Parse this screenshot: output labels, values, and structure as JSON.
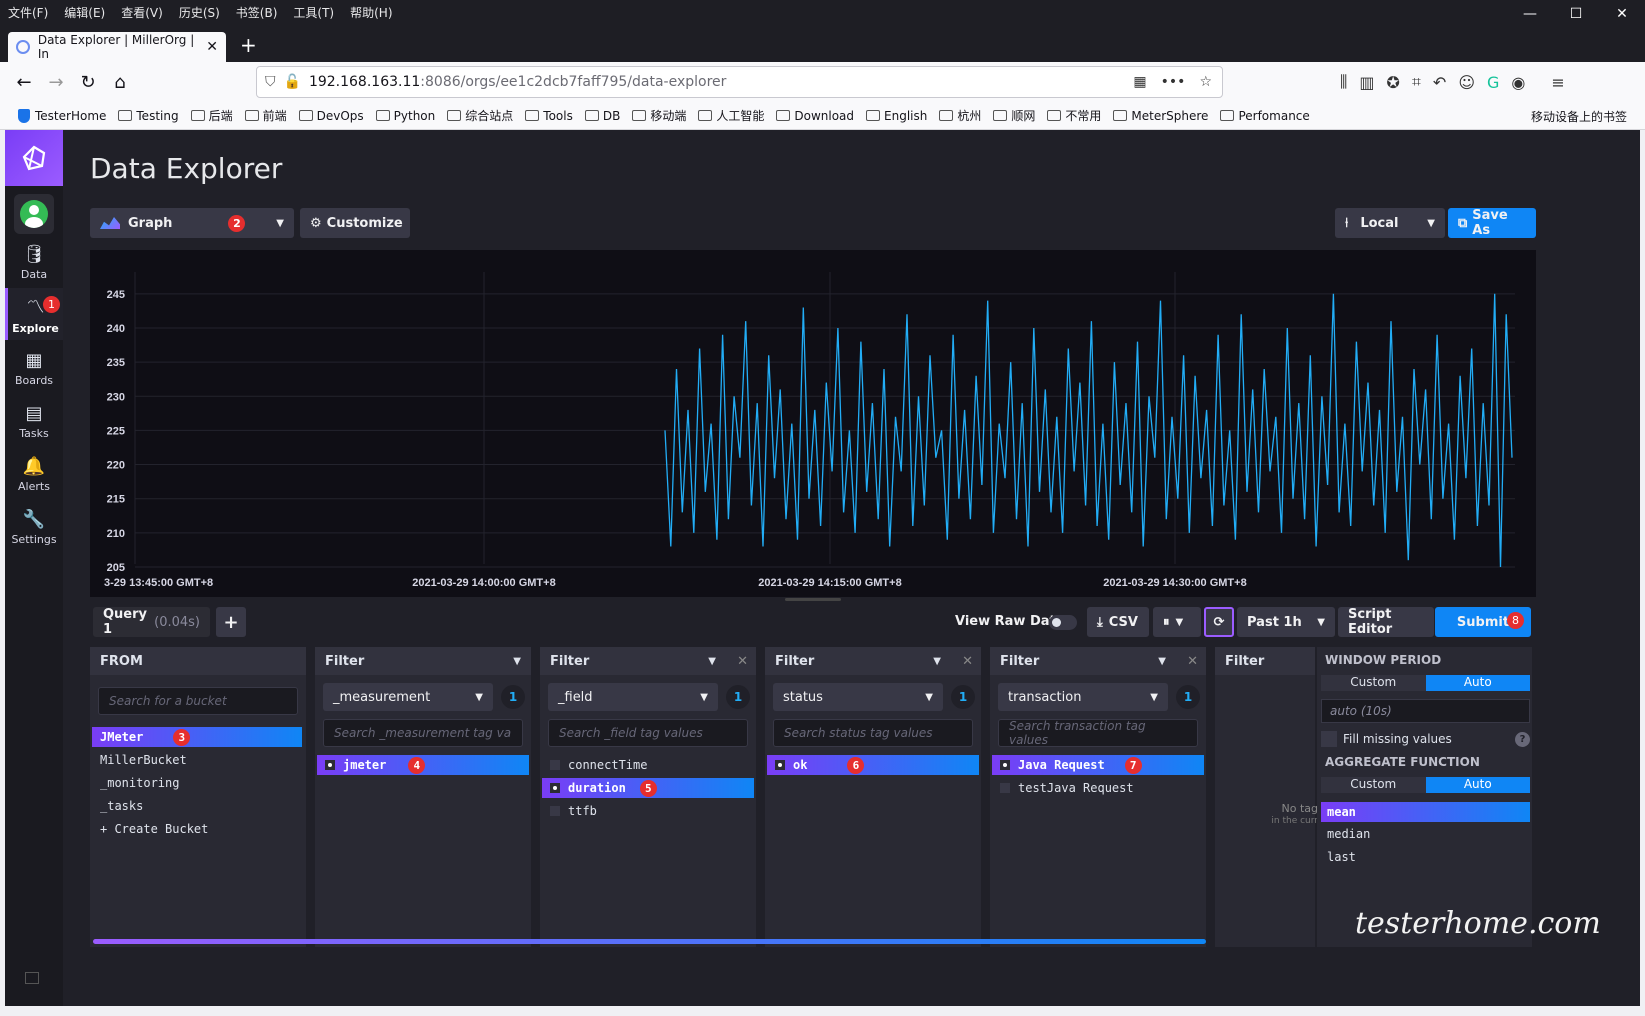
{
  "menubar": {
    "items": [
      "文件(F)",
      "编辑(E)",
      "查看(V)",
      "历史(S)",
      "书签(B)",
      "工具(T)",
      "帮助(H)"
    ],
    "window_controls": [
      "—",
      "☐",
      "✕"
    ]
  },
  "tab": {
    "title": "Data Explorer | MillerOrg | In",
    "close": "✕",
    "new": "+"
  },
  "urlbar": {
    "host": "192.168.163.11",
    "path": ":8086/orgs/ee1c2dcb7faff795/data-explorer"
  },
  "bookmarks": {
    "items": [
      "TesterHome",
      "Testing",
      "后端",
      "前端",
      "DevOps",
      "Python",
      "综合站点",
      "Tools",
      "DB",
      "移动端",
      "人工智能",
      "Download",
      "English",
      "杭州",
      "顺网",
      "不常用",
      "MeterSphere",
      "Perfomance"
    ],
    "mobile": "移动设备上的书签"
  },
  "nav": {
    "items": [
      {
        "label": "Data",
        "icon": "database-icon"
      },
      {
        "label": "Explore",
        "icon": "explore-icon",
        "badge": "1"
      },
      {
        "label": "Boards",
        "icon": "dashboard-icon"
      },
      {
        "label": "Tasks",
        "icon": "calendar-icon"
      },
      {
        "label": "Alerts",
        "icon": "bell-icon"
      },
      {
        "label": "Settings",
        "icon": "wrench-icon"
      }
    ]
  },
  "page": {
    "title": "Data Explorer",
    "graph_type": "Graph",
    "graph_badge": "2",
    "customize": "Customize",
    "timezone": "Local",
    "save_as": "Save As"
  },
  "chart_data": {
    "type": "line",
    "color": "#22adf6",
    "ylim": [
      205,
      246
    ],
    "y_ticks": [
      245,
      240,
      235,
      230,
      225,
      220,
      215,
      210,
      205
    ],
    "x_tick_labels": [
      "3-29 13:45:00 GMT+8",
      "2021-03-29 14:00:00 GMT+8",
      "2021-03-29 14:15:00 GMT+8",
      "2021-03-29 14:30:00 GMT+8"
    ],
    "series": [
      {
        "values": [
          225,
          208,
          234,
          213,
          228,
          210,
          237,
          216,
          226,
          209,
          239,
          212,
          230,
          221,
          241,
          214,
          229,
          208,
          236,
          218,
          231,
          212,
          226,
          209,
          243,
          215,
          228,
          211,
          232,
          219,
          240,
          213,
          225,
          210,
          238,
          216,
          229,
          212,
          234,
          208,
          227,
          219,
          242,
          211,
          230,
          214,
          236,
          221,
          225,
          209,
          239,
          215,
          228,
          212,
          233,
          217,
          244,
          210,
          226,
          218,
          235,
          212,
          229,
          208,
          240,
          216,
          231,
          213,
          227,
          210,
          237,
          219,
          232,
          214,
          241,
          211,
          226,
          209,
          235,
          217,
          229,
          213,
          238,
          208,
          230,
          221,
          244,
          212,
          227,
          215,
          236,
          210,
          233,
          218,
          228,
          211,
          239,
          214,
          225,
          209,
          242,
          216,
          231,
          213,
          234,
          219,
          227,
          210,
          240,
          215,
          229,
          212,
          236,
          208,
          230,
          217,
          245,
          213,
          226,
          211,
          238,
          219,
          232,
          214,
          228,
          210,
          241,
          216,
          227,
          206,
          234,
          220,
          231,
          212,
          239,
          215,
          226,
          209,
          233,
          218,
          237,
          211,
          229,
          214,
          245,
          205,
          242,
          221
        ]
      }
    ]
  },
  "query": {
    "tab_label": "Query 1",
    "tab_time": "(0.04s)",
    "add": "+",
    "view_raw": "View Raw Data",
    "csv": "CSV",
    "pause": "⏸",
    "range": "Past 1h",
    "script_editor": "Script Editor",
    "submit": "Submit",
    "submit_badge": "8"
  },
  "from": {
    "title": "FROM",
    "placeholder": "Search for a bucket",
    "items": [
      "JMeter",
      "MillerBucket",
      "_monitoring",
      "_tasks",
      "+ Create Bucket"
    ],
    "selected_badge": "3"
  },
  "filters": [
    {
      "title": "Filter",
      "key": "_measurement",
      "count": "1",
      "placeholder": "Search _measurement tag va",
      "items": [
        "jmeter"
      ],
      "selected": [
        0
      ],
      "badge": "4"
    },
    {
      "title": "Filter",
      "key": "_field",
      "count": "1",
      "placeholder": "Search _field tag values",
      "items": [
        "connectTime",
        "duration",
        "ttfb"
      ],
      "selected": [
        1
      ],
      "badge": "5"
    },
    {
      "title": "Filter",
      "key": "status",
      "count": "1",
      "placeholder": "Search status tag values",
      "items": [
        "ok"
      ],
      "selected": [
        0
      ],
      "badge": "6"
    },
    {
      "title": "Filter",
      "key": "transaction",
      "count": "1",
      "placeholder": "Search transaction tag values",
      "items": [
        "Java Request",
        "testJava Request"
      ],
      "selected": [
        0
      ],
      "badge": "7"
    }
  ],
  "empty_filter": {
    "title": "Filter",
    "no_tag": "No tag",
    "no_tag_sub": "in the curr"
  },
  "agg": {
    "window_title": "WINDOW PERIOD",
    "custom": "Custom",
    "auto": "Auto",
    "auto_value": "auto (10s)",
    "fill_missing": "Fill missing values",
    "help": "?",
    "agg_title": "AGGREGATE FUNCTION",
    "functions": [
      "mean",
      "median",
      "last"
    ]
  },
  "watermark": "testerhome.com"
}
